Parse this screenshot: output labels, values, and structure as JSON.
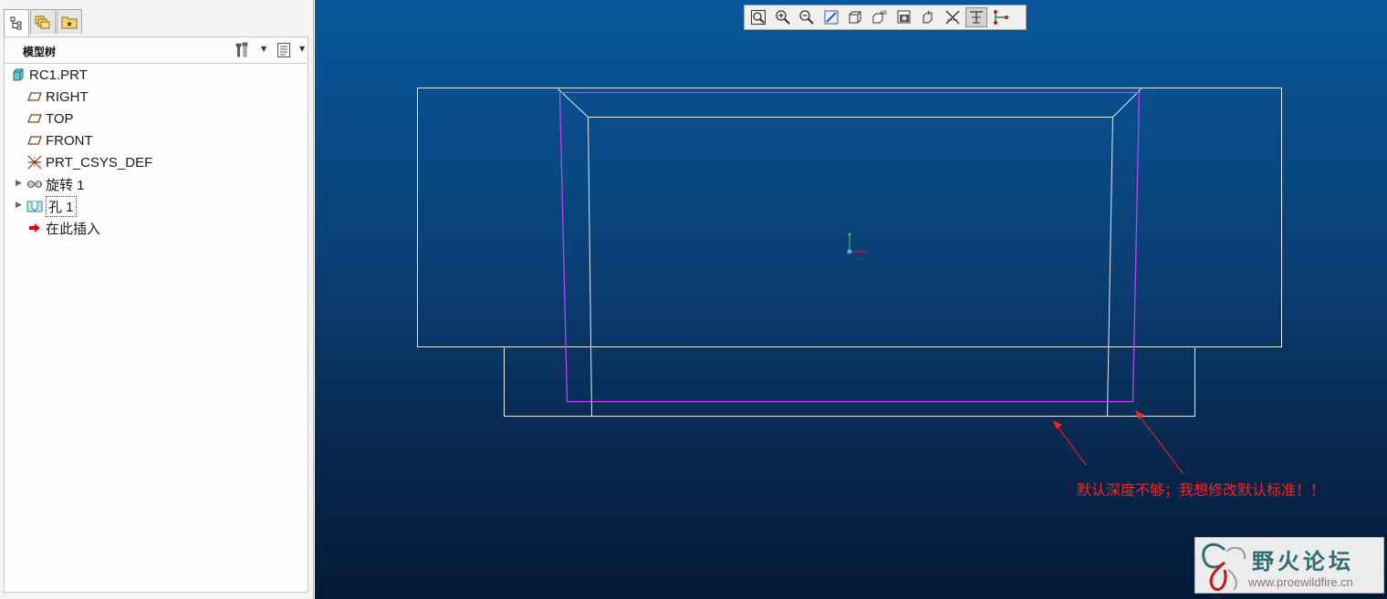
{
  "left_panel": {
    "tabs": [
      {
        "icon": "model-tree-icon"
      },
      {
        "icon": "folder-browser-icon"
      },
      {
        "icon": "favorites-icon"
      }
    ],
    "header": {
      "title": "模型树",
      "settings_icon": "tools-icon",
      "show_icon": "columns-icon"
    },
    "tree": [
      {
        "label": "RC1.PRT",
        "icon": "part-icon"
      },
      {
        "label": "RIGHT",
        "icon": "datum-plane-icon"
      },
      {
        "label": "TOP",
        "icon": "datum-plane-icon"
      },
      {
        "label": "FRONT",
        "icon": "datum-plane-icon"
      },
      {
        "label": "PRT_CSYS_DEF",
        "icon": "csys-icon"
      },
      {
        "label": "旋转 1",
        "icon": "revolve-icon",
        "expandable": true
      },
      {
        "label": "孔 1",
        "icon": "hole-icon",
        "expandable": true,
        "selected": true
      },
      {
        "label": "在此插入",
        "icon": "insert-arrow-icon"
      }
    ]
  },
  "viewport": {
    "toolbar": [
      {
        "icon": "refit-icon"
      },
      {
        "icon": "zoom-in-icon"
      },
      {
        "icon": "zoom-out-icon"
      },
      {
        "icon": "repaint-icon"
      },
      {
        "icon": "display-style-icon"
      },
      {
        "icon": "saved-views-icon"
      },
      {
        "icon": "view-manager-icon"
      },
      {
        "icon": "perspective-icon"
      },
      {
        "icon": "datum-display-icon"
      },
      {
        "icon": "annotation-display-icon",
        "pressed": true
      },
      {
        "icon": "point-display-icon"
      }
    ],
    "annotation_text": "默认深度不够；我想修改默认标准！！",
    "watermark": {
      "title": "野火论坛",
      "url": "www.proewildfire.cn"
    }
  },
  "colors": {
    "panel_bg": "#f3f3f3",
    "viewport_top": "#08589a",
    "viewport_bottom": "#041a36",
    "edge_line": "#e8eef4",
    "highlight": "#c040ff",
    "annotation": "#ff2020",
    "logo_text": "#2f6d73"
  }
}
